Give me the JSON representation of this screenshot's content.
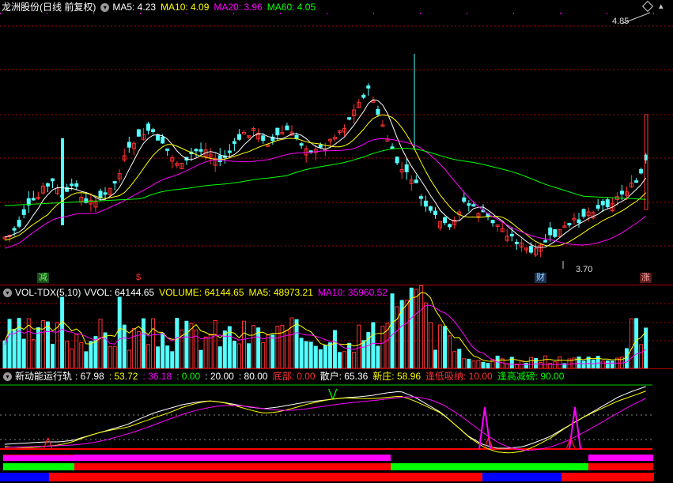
{
  "main_panel": {
    "title": "龙洲股份(日线 前复权)",
    "ma_labels": [
      {
        "text": "MA5: 4.23",
        "color": "#ffffff"
      },
      {
        "text": "MA10: 4.09",
        "color": "#ffff00"
      },
      {
        "text": "MA20: 3.96",
        "color": "#ff00ff"
      },
      {
        "text": "MA60: 4.05",
        "color": "#00ff00"
      }
    ],
    "high_label": "4.85",
    "low_label": "3.70",
    "event_badges": [
      {
        "text": "减",
        "bg": "#1a4d1a",
        "fg": "#66ff66"
      },
      {
        "text": "$",
        "bg": "#000000",
        "fg": "#ff3333"
      },
      {
        "text": "财",
        "bg": "#1a3355",
        "fg": "#99ccff"
      },
      {
        "text": "涨",
        "bg": "#5a1a1a",
        "fg": "#ffaaaa"
      }
    ]
  },
  "volume_panel": {
    "title": "VOL-TDX(5,10)",
    "labels": [
      {
        "text": "VVOL: 64144.65",
        "color": "#ffffff"
      },
      {
        "text": "VOLUME: 64144.65",
        "color": "#ffff00"
      },
      {
        "text": "MA5: 48973.21",
        "color": "#ffff00"
      },
      {
        "text": "MA10: 35960.52",
        "color": "#ff00ff"
      }
    ]
  },
  "indicator_panel": {
    "title": "新动能运行轨",
    "labels": [
      {
        "text": ": 67.98",
        "color": "#ffffff"
      },
      {
        "text": ": 53.72",
        "color": "#ffff00"
      },
      {
        "text": ": 36.18",
        "color": "#ff00ff"
      },
      {
        "text": ": 0.00",
        "color": "#00ff00"
      },
      {
        "text": ": 20.00",
        "color": "#ffffff"
      },
      {
        "text": ": 80.00",
        "color": "#ffffff"
      },
      {
        "text": "底部: 0.00",
        "color": "#ff3333"
      },
      {
        "text": "散户: 65.36",
        "color": "#ffffff"
      },
      {
        "text": "新庄: 58.96",
        "color": "#ffff00"
      },
      {
        "text": "逢低吸纳: 10.00",
        "color": "#ff3333"
      },
      {
        "text": "逢高减磅: 90.00",
        "color": "#00ff00"
      }
    ]
  },
  "colors": {
    "up": "#ff3232",
    "down": "#54ffff",
    "ma5": "#ffffff",
    "ma10": "#ffff00",
    "ma20": "#ff00ff",
    "ma60": "#00ff00"
  }
}
